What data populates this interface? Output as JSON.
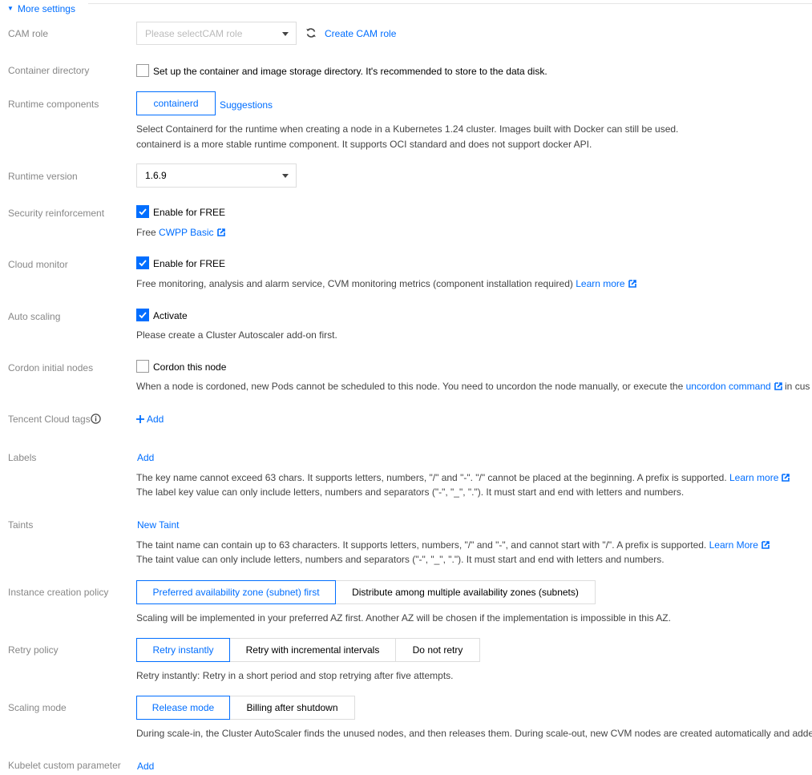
{
  "section": {
    "toggle_label": "More settings"
  },
  "cam_role": {
    "label": "CAM role",
    "placeholder": "Please selectCAM role",
    "create_link": "Create CAM role"
  },
  "container_dir": {
    "label": "Container directory",
    "checkbox_text": "Set up the container and image storage directory. It's recommended to store to the data disk.",
    "checked": false
  },
  "runtime_components": {
    "label": "Runtime components",
    "option": "containerd",
    "suggestions_link": "Suggestions",
    "help1": "Select Containerd for the runtime when creating a node in a Kubernetes 1.24 cluster. Images built with Docker can still be used.",
    "help2": "containerd is a more stable runtime component. It supports OCI standard and does not support docker API."
  },
  "runtime_version": {
    "label": "Runtime version",
    "value": "1.6.9"
  },
  "security": {
    "label": "Security reinforcement",
    "checkbox_text": "Enable for FREE",
    "checked": true,
    "free_prefix": "Free",
    "cwpp_link": "CWPP Basic"
  },
  "cloud_monitor": {
    "label": "Cloud monitor",
    "checkbox_text": "Enable for FREE",
    "checked": true,
    "help": "Free monitoring, analysis and alarm service, CVM monitoring metrics (component installation required)",
    "learn_more": "Learn more"
  },
  "auto_scaling": {
    "label": "Auto scaling",
    "checkbox_text": "Activate",
    "checked": true,
    "help": "Please create a Cluster Autoscaler add-on first."
  },
  "cordon": {
    "label": "Cordon initial nodes",
    "checkbox_text": "Cordon this node",
    "checked": false,
    "help_prefix": "When a node is cordoned, new Pods cannot be scheduled to this node. You need to uncordon the node manually, or execute the",
    "uncordon_link": "uncordon command",
    "help_suffix": "in cus"
  },
  "tags": {
    "label": "Tencent Cloud tags",
    "add_label": "Add",
    "add_icon": "plus-icon"
  },
  "labels": {
    "label": "Labels",
    "add_label": "Add",
    "help1": "The key name cannot exceed 63 chars. It supports letters, numbers, \"/\" and \"-\". \"/\" cannot be placed at the beginning. A prefix is supported.",
    "learn_more": "Learn more",
    "help2": "The label key value can only include letters, numbers and separators (\"-\", \"_\", \".\"). It must start and end with letters and numbers."
  },
  "taints": {
    "label": "Taints",
    "new_taint": "New Taint",
    "help1": "The taint name can contain up to 63 characters. It supports letters, numbers, \"/\" and \"-\", and cannot start with \"/\". A prefix is supported.",
    "learn_more": "Learn More",
    "help2": "The taint value can only include letters, numbers and separators (\"-\", \"_\", \".\"). It must start and end with letters and numbers."
  },
  "instance_policy": {
    "label": "Instance creation policy",
    "options": [
      "Preferred availability zone (subnet) first",
      "Distribute among multiple availability zones (subnets)"
    ],
    "selected": 0,
    "help": "Scaling will be implemented in your preferred AZ first. Another AZ will be chosen if the implementation is impossible in this AZ."
  },
  "retry_policy": {
    "label": "Retry policy",
    "options": [
      "Retry instantly",
      "Retry with incremental intervals",
      "Do not retry"
    ],
    "selected": 0,
    "help": "Retry instantly: Retry in a short period and stop retrying after five attempts."
  },
  "scaling_mode": {
    "label": "Scaling mode",
    "options": [
      "Release mode",
      "Billing after shutdown"
    ],
    "selected": 0,
    "help": "During scale-in, the Cluster AutoScaler finds the unused nodes, and then releases them. During scale-out, new CVM nodes are created automatically and added"
  },
  "kubelet": {
    "label": "Kubelet custom parameter",
    "add_label": "Add"
  },
  "colors": {
    "accent": "#006eff",
    "label_gray": "#888888",
    "border": "#dddddd"
  }
}
